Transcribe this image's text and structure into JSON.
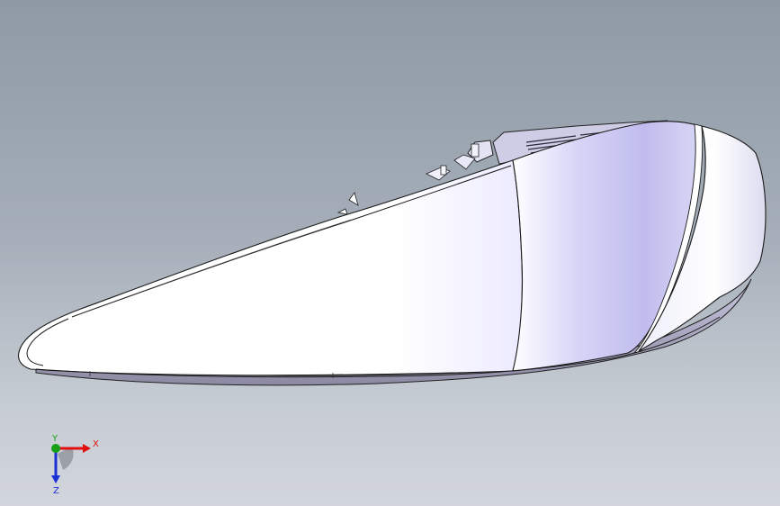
{
  "viewport": {
    "background_top": "#8f9aa6",
    "background_bottom": "#d2d6dc"
  },
  "model": {
    "body_color": "#ffffff",
    "shade_color": "#b9b7ee",
    "edge_color": "#1a1a1a"
  },
  "triad": {
    "x_label": "X",
    "y_label": "Y",
    "z_label": "Z",
    "x_color": "#e01010",
    "y_color": "#17a017",
    "z_color": "#1b2fd6"
  }
}
